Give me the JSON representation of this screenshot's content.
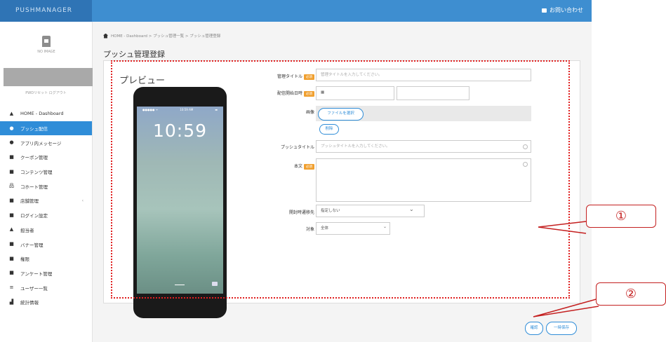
{
  "topbar": {
    "brand": "PUSHMANAGER",
    "contact": "お問い合わせ"
  },
  "sidebar": {
    "logo_label": "NO IMAGE",
    "user_links": "PWDリセット    ログアウト",
    "items": [
      {
        "label": "HOME - Dashboard",
        "icon": "home-icon",
        "glyph": "▲"
      },
      {
        "label": "プッシュ配信",
        "icon": "bullet-icon",
        "glyph": "●"
      },
      {
        "label": "アプリ内メッセージ",
        "icon": "chat-icon",
        "glyph": "●"
      },
      {
        "label": "クーポン管理",
        "icon": "ticket-icon",
        "glyph": "■"
      },
      {
        "label": "コンテンツ管理",
        "icon": "doc-icon",
        "glyph": "■"
      },
      {
        "label": "コホート管理",
        "icon": "sitemap-icon",
        "glyph": "品"
      },
      {
        "label": "店舗管理",
        "icon": "store-icon",
        "glyph": "■"
      },
      {
        "label": "ログイン設定",
        "icon": "lock-icon",
        "glyph": "■"
      },
      {
        "label": "担当者",
        "icon": "user-icon",
        "glyph": "▲"
      },
      {
        "label": "バナー管理",
        "icon": "banner-icon",
        "glyph": "■"
      },
      {
        "label": "権限",
        "icon": "check-icon",
        "glyph": "■"
      },
      {
        "label": "アンケート管理",
        "icon": "survey-icon",
        "glyph": "■"
      },
      {
        "label": "ユーザー一覧",
        "icon": "list-icon",
        "glyph": "≡"
      },
      {
        "label": "統計情報",
        "icon": "chart-icon",
        "glyph": "▟"
      }
    ]
  },
  "main": {
    "breadcrumb": "HOME - Dashboard  >  プッシュ管理一覧  >  プッシュ管理登録",
    "title": "プッシュ管理登録"
  },
  "preview": {
    "title": "プレビュー",
    "clock": "10:59",
    "carrier": "●●●●● ᯤ",
    "time": "10:59 AM",
    "battery": "▬"
  },
  "form": {
    "mgmt_title_label": "管理タイトル",
    "mgmt_title_placeholder": "管理タイトルを入力してください。",
    "schedule_label": "配信開始日時",
    "calendar_icon": "▦",
    "image_label": "画像",
    "file_button": "ファイルを選択",
    "delete_button": "削除",
    "push_title_label": "プッシュタイトル",
    "push_title_placeholder": "プッシュタイトルを入力してください。",
    "body_label": "本文",
    "destination_label": "開封時遷移先",
    "destination_value": "指定しない",
    "target_label": "対象",
    "target_value": "全体",
    "required_badge": "必須",
    "chevron": "⌄"
  },
  "footer": {
    "confirm": "確認",
    "save_draft": "一時保存"
  },
  "annotations": {
    "callout1": "①",
    "callout2": "②"
  },
  "colors": {
    "accent": "#2f8dd8",
    "topbar": "#3e8ed0",
    "annotation": "#c42020",
    "required": "#f0a030"
  }
}
